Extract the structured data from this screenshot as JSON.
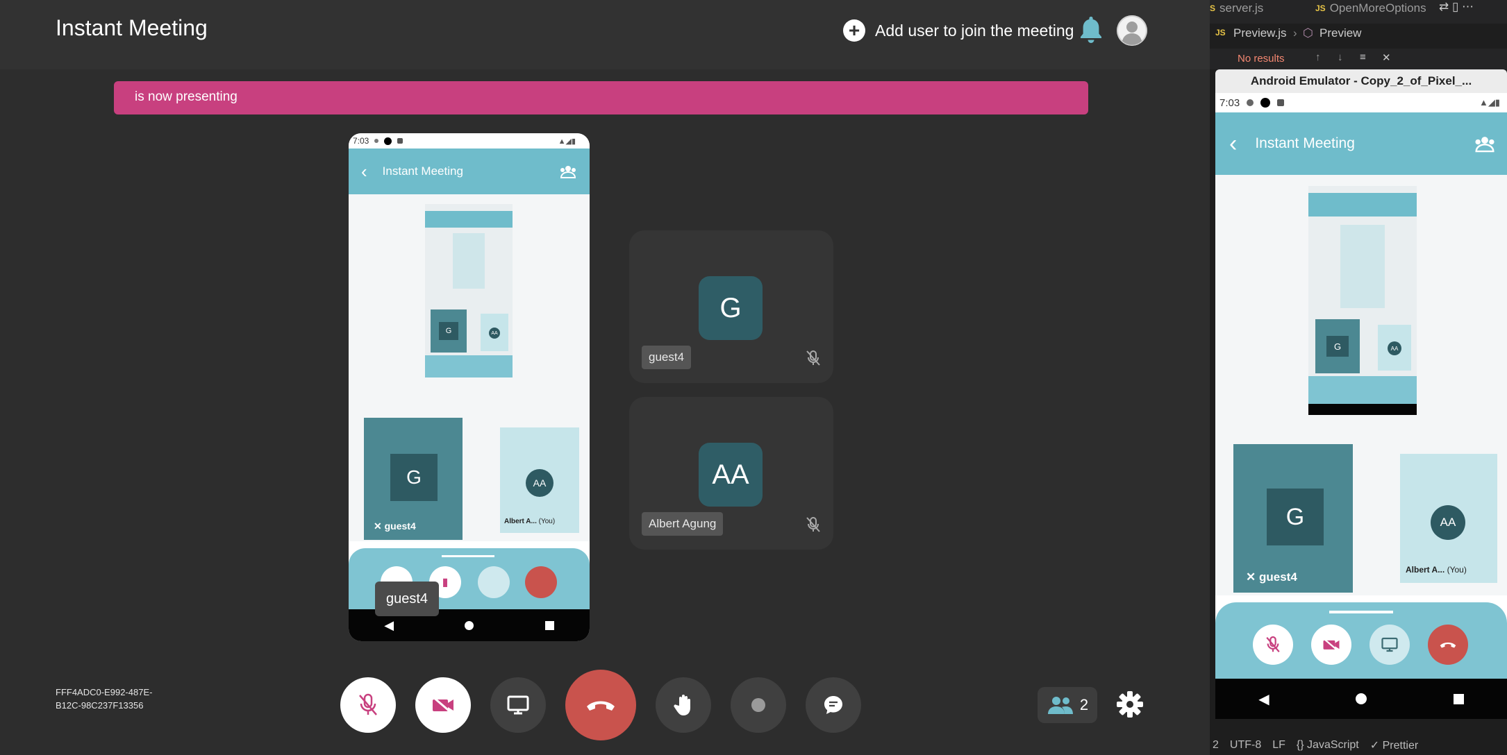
{
  "app": {
    "title": "Instant Meeting",
    "add_user_label": "Add user to join the meeting",
    "banner_text": "is now presenting",
    "meeting_id": "FFF4ADC0-E992-487E-B12C-98C237F13356",
    "participant_count": "2",
    "tooltip": "guest4",
    "colors": {
      "accent": "#c8407f",
      "end_call": "#c9534d",
      "teal": "#6fbccb"
    }
  },
  "participants": [
    {
      "initials": "G",
      "name": "guest4"
    },
    {
      "initials": "AA",
      "name": "Albert Agung"
    }
  ],
  "controls": [
    "mic-off-icon",
    "camera-off-icon",
    "screen-share-icon",
    "end-call-icon",
    "raise-hand-icon",
    "record-icon",
    "chat-icon"
  ],
  "shared_phone": {
    "time": "7:03",
    "title": "Instant Meeting",
    "tile_g": "G",
    "tile_g_name": "guest4",
    "tile_aa": "AA",
    "tile_aa_name": "Albert A...",
    "tile_aa_you": "(You)"
  },
  "editor": {
    "tab1": "server.js",
    "tab2": "OpenMoreOptions",
    "crumb_file": "Preview.js",
    "crumb_symbol": "Preview",
    "find_result": "No results",
    "emulator_title": "Android Emulator - Copy_2_of_Pixel_...",
    "status": {
      "line": "2",
      "encoding": "UTF-8",
      "eol": "LF",
      "language": "JavaScript",
      "formatter": "Prettier"
    }
  },
  "emulator_phone": {
    "time": "7:03",
    "title": "Instant Meeting",
    "tile_g": "G",
    "tile_g_name": "guest4",
    "tile_aa": "AA",
    "tile_aa_name": "Albert A...",
    "tile_aa_you": "(You)"
  }
}
